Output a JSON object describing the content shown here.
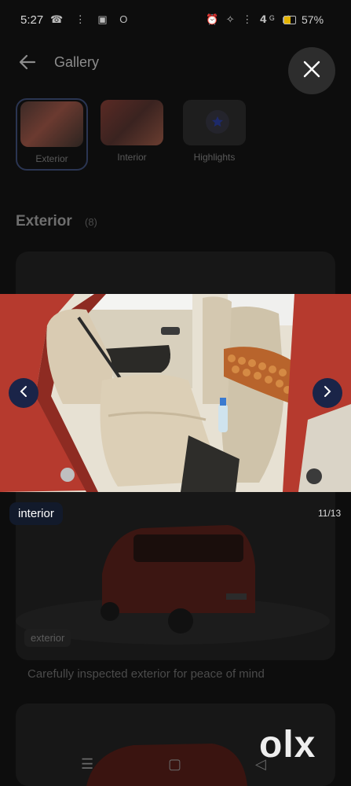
{
  "status": {
    "time": "5:27",
    "left_icons": "☎ ⋮ ▣ O",
    "right_icons": "⏰ ✧ ⋮ 𝟰ᴳ ıl",
    "battery": "57%",
    "battery_level": 0.57
  },
  "header": {
    "title": "Gallery",
    "back_icon": "arrow-left-icon",
    "close_icon": "close-icon"
  },
  "tabs": [
    {
      "label": "Exterior",
      "selected": true
    },
    {
      "label": "Interior",
      "selected": false
    },
    {
      "label": "Highlights",
      "selected": false
    }
  ],
  "section": {
    "title": "Exterior",
    "count": "(8)"
  },
  "viewer": {
    "tag": "interior",
    "counter": "11/13"
  },
  "card": {
    "tag": "exterior",
    "caption": "Carefully inspected exterior for peace of mind"
  },
  "watermark": "olx",
  "colors": {
    "nav_button": "#1a2448",
    "tab_border": "#2a3552",
    "car_red": "#b63a2e",
    "seat_beige": "#d9cbb2"
  }
}
